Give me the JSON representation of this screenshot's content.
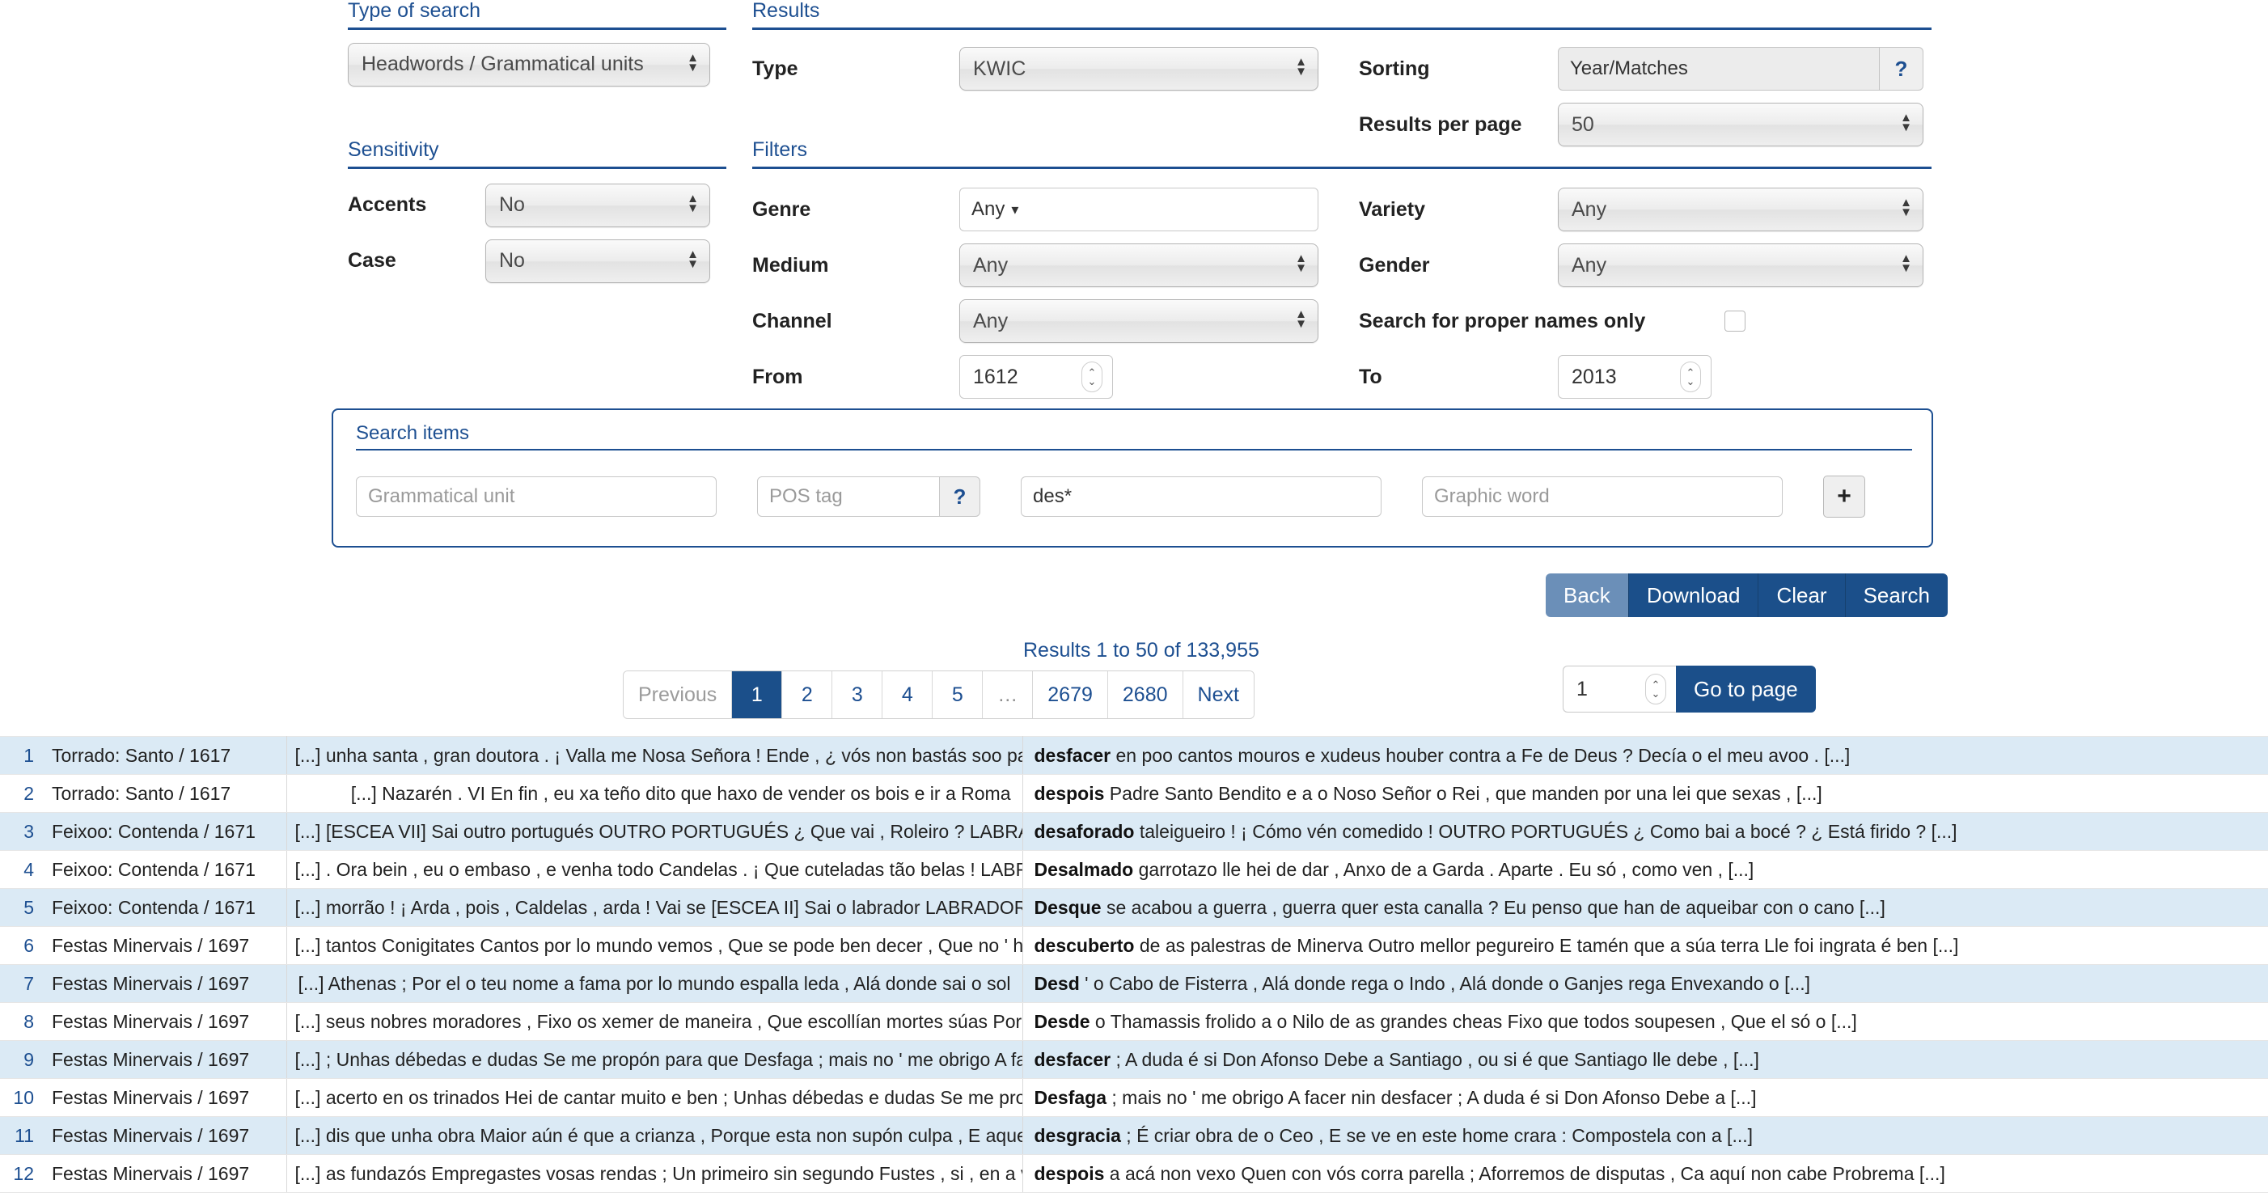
{
  "type_of_search": {
    "heading": "Type of search",
    "value": "Headwords / Grammatical units"
  },
  "sensitivity": {
    "heading": "Sensitivity",
    "accents_label": "Accents",
    "accents_value": "No",
    "case_label": "Case",
    "case_value": "No"
  },
  "results": {
    "heading": "Results",
    "type_label": "Type",
    "type_value": "KWIC",
    "sorting_label": "Sorting",
    "sorting_value": "Year/Matches",
    "sorting_help": "?",
    "per_page_label": "Results per page",
    "per_page_value": "50"
  },
  "filters": {
    "heading": "Filters",
    "genre_label": "Genre",
    "genre_value": "Any",
    "medium_label": "Medium",
    "medium_value": "Any",
    "channel_label": "Channel",
    "channel_value": "Any",
    "from_label": "From",
    "from_value": "1612",
    "variety_label": "Variety",
    "variety_value": "Any",
    "gender_label": "Gender",
    "gender_value": "Any",
    "proper_names_label": "Search for proper names only",
    "to_label": "To",
    "to_value": "2013"
  },
  "search_items": {
    "heading": "Search items",
    "grammatical_unit_placeholder": "Grammatical unit",
    "pos_tag_placeholder": "POS tag",
    "pos_tag_help": "?",
    "lemma_value": "des*",
    "graphic_word_placeholder": "Graphic word",
    "add_label": "+"
  },
  "actions": {
    "back": "Back",
    "download": "Download",
    "clear": "Clear",
    "search": "Search"
  },
  "pagination": {
    "results_count": "Results 1 to 50 of 133,955",
    "previous": "Previous",
    "pages": [
      "1",
      "2",
      "3",
      "4",
      "5",
      "…",
      "2679",
      "2680"
    ],
    "active_page": "1",
    "next": "Next",
    "goto_value": "1",
    "goto_label": "Go to page"
  },
  "table": {
    "rows": [
      {
        "num": "1",
        "source": "Torrado: Santo / 1617",
        "left": "[...] unha santa , gran doutora . ¡ Valla me Nosa Señora ! Ende , ¿ vós non bastás soo para",
        "keyword": "desfacer",
        "right": "en poo cantos mouros e xudeus houber contra a Fe de Deus ? Decía o el meu avoo . [...]"
      },
      {
        "num": "2",
        "source": "Torrado: Santo / 1617",
        "left": "[...] Nazarén . VI En fin , eu xa teño dito que haxo de vender os bois e ir a Roma",
        "keyword": "despois",
        "right": "Padre Santo Bendito e a o Noso Señor o Rei , que manden por una lei que sexas , [...]"
      },
      {
        "num": "3",
        "source": "Feixoo: Contenda / 1671",
        "left": "[...] [ESCEA VII] Sai outro portugués OUTRO PORTUGUÉS ¿ Que vai , Roleiro ? LABRADOR Aparte ¡ Pá ! ¡ Qué",
        "keyword": "desaforado",
        "right": "taleigueiro ! ¡ Cómo vén comedido ! OUTRO PORTUGUÉS ¿ Como bai a bocé ? ¿ Está firido ? [...]"
      },
      {
        "num": "4",
        "source": "Feixoo: Contenda / 1671",
        "left": "[...] . Ora bein , eu o embaso , e venha todo Candelas . ¡ Que cuteladas tão belas ! LABRADOR",
        "keyword": "Desalmado",
        "right": "garrotazo lle hei de dar , Anxo de a Garda . Aparte . Eu só , como ven , [...]"
      },
      {
        "num": "5",
        "source": "Feixoo: Contenda / 1671",
        "left": "[...] morrão ! ¡ Arda , pois , Caldelas , arda ! Vai se [ESCEA II] Sai o labrador LABRADOR ¿",
        "keyword": "Desque",
        "right": "se acabou a guerra , guerra quer esta canalla ? Eu penso que han de aqueibar con o cano [...]"
      },
      {
        "num": "6",
        "source": "Festas Minervais / 1697",
        "left": "[...] tantos Conigitates Cantos por lo mundo vemos , Que se pode ben decer , Que no ' hai en o",
        "keyword": "descuberto",
        "right": "de as palestras de Minerva Outro mellor pegureiro E tamén que a súa terra Lle foi ingrata é ben [...]"
      },
      {
        "num": "7",
        "source": "Festas Minervais / 1697",
        "left": "[...] Athenas ; Por el o teu nome a fama por lo mundo espalla leda , Alá donde sai o sol",
        "keyword": "Desd",
        "right": "' o Cabo de Fisterra , Alá donde rega o Indo , Alá donde o Ganjes rega Envexando o [...]"
      },
      {
        "num": "8",
        "source": "Festas Minervais / 1697",
        "left": "[...] seus nobres moradores , Fixo os xemer de maneira , Que escollían mortes súas Por non ver mortes alleas ;",
        "keyword": "Desde",
        "right": "o Thamassis frolido a o Nilo de as grandes cheas Fixo que todos soupesen , Que el só o [...]"
      },
      {
        "num": "9",
        "source": "Festas Minervais / 1697",
        "left": "[...] ; Unhas débedas e dudas Se me propón para que Desfaga ; mais no ' me obrigo A facer nin",
        "keyword": "desfacer",
        "right": "; A duda é si Don Afonso Debe a Santiago , ou si é que Santiago lle debe , [...]"
      },
      {
        "num": "10",
        "source": "Festas Minervais / 1697",
        "left": "[...] acerto en os trinados Hei de cantar muito e ben ; Unhas débedas e dudas Se me propón para que",
        "keyword": "Desfaga",
        "right": "; mais no ' me obrigo A facer nin desfacer ; A duda é si Don Afonso Debe a [...]"
      },
      {
        "num": "11",
        "source": "Festas Minervais / 1697",
        "left": "[...] dis que unha obra Maior aún é que a crianza , Porque esta non supón culpa , E aquela supón",
        "keyword": "desgracia",
        "right": "; É criar obra de o Ceo , E se ve en este home crara : Compostela con a [...]"
      },
      {
        "num": "12",
        "source": "Festas Minervais / 1697",
        "left": "[...] as fundazós Empregastes vosas rendas ; Un primeiro sin segundo Fustes , si , en a vosa era , E",
        "keyword": "despois",
        "right": "a acá non vexo Quen con vós corra parella ; Aforremos de disputas , Ca aquí non cabe Probrema [...]"
      }
    ]
  },
  "colors": {
    "brand_blue": "#1d4f91",
    "button_blue": "#1b4f8a",
    "button_light": "#6b8fb8",
    "row_stripe": "#dbeaf5"
  }
}
